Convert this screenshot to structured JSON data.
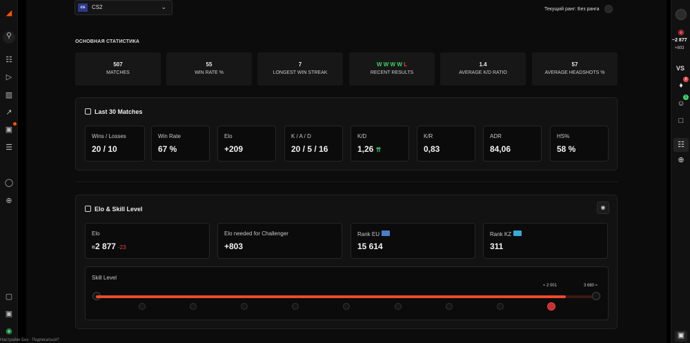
{
  "header": {
    "game_logo": "cs",
    "game_name": "CS2",
    "rank_text": "Текущий ранг: Без ранга"
  },
  "main_stats": {
    "title": "ОСНОВНАЯ СТАТИСТИКА",
    "items": [
      {
        "value": "507",
        "label": "MATCHES"
      },
      {
        "value": "55",
        "label": "WIN RATE %"
      },
      {
        "value": "7",
        "label": "LONGEST WIN STREAK"
      },
      {
        "value": "",
        "label": "RECENT RESULTS",
        "results": [
          "W",
          "W",
          "W",
          "W",
          "L"
        ]
      },
      {
        "value": "1.4",
        "label": "AVERAGE K/D RATIO"
      },
      {
        "value": "57",
        "label": "AVERAGE HEADSHOTS %"
      }
    ]
  },
  "last30": {
    "title": "Last 30 Matches",
    "cards": [
      {
        "label": "Wins / Losses",
        "value": "20 / 10"
      },
      {
        "label": "Win Rate",
        "value": "67 %"
      },
      {
        "label": "Elo",
        "value": "+209"
      },
      {
        "label": "K / A / D",
        "value": "20 / 5 / 16"
      },
      {
        "label": "K/D",
        "value": "1,26"
      },
      {
        "label": "K/R",
        "value": "0,83"
      },
      {
        "label": "ADR",
        "value": "84,06"
      },
      {
        "label": "HS%",
        "value": "58 %"
      }
    ]
  },
  "elo_skill": {
    "title": "Elo & Skill Level",
    "elo_label": "Elo",
    "elo_value": "2 877",
    "elo_change": "-23",
    "challenger_label": "Elo needed for Challenger",
    "challenger_value": "+803",
    "rank_eu_label": "Rank EU",
    "rank_eu_value": "15 614",
    "rank_kz_label": "Rank KZ",
    "rank_kz_value": "311",
    "skill_label": "Skill Level",
    "marker_current": "2 001",
    "marker_max": "3 680",
    "progress": 0.94,
    "accent_color": "#ee4b2b"
  },
  "right_rail": {
    "elo": "~2 877",
    "delta": "+803",
    "vs": "VS",
    "notif_count": "9",
    "friends_count": "1"
  },
  "footer": {
    "text": "Настройки Без · Подписаться?"
  },
  "icons": {
    "logo": "faceit-logo-icon",
    "search": "search-icon",
    "play": "play-icon",
    "stats": "stats-icon"
  }
}
